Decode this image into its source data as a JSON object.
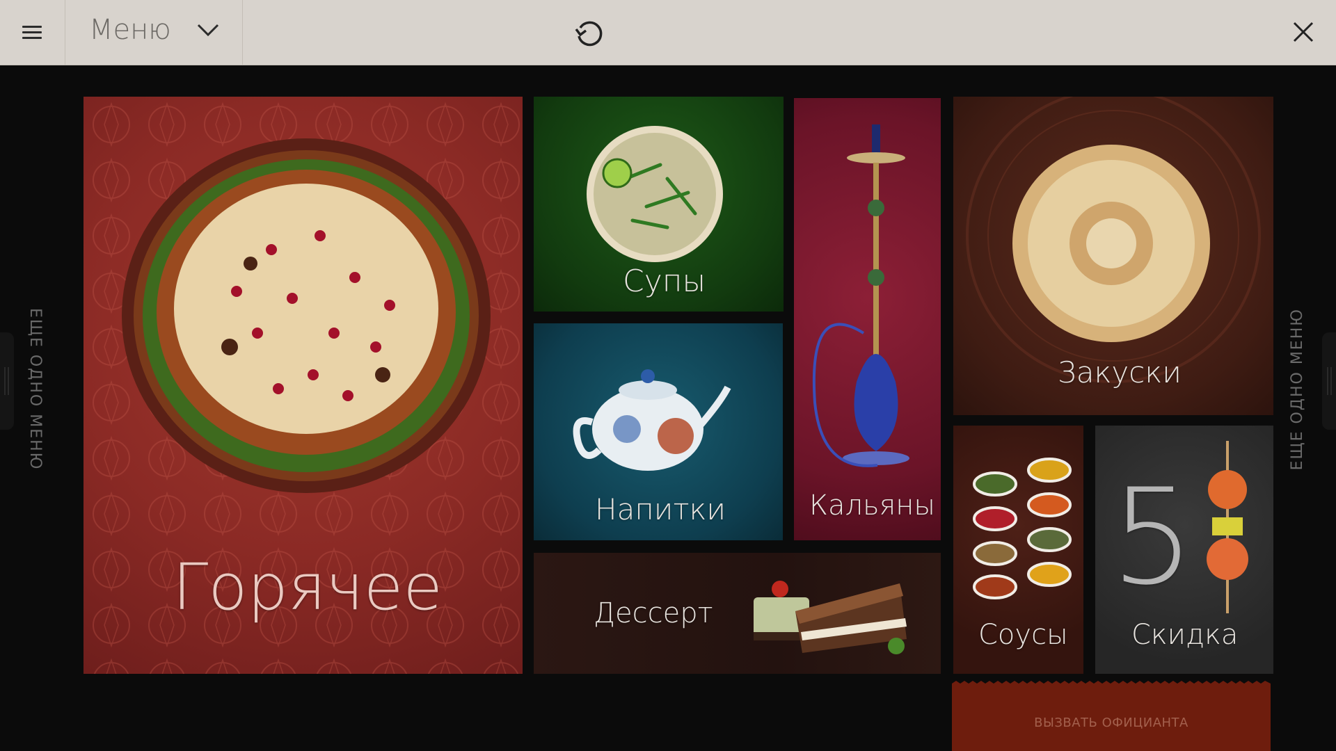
{
  "topbar": {
    "menu_label": "Меню",
    "icons": [
      "hamburger-icon",
      "chevron-down-icon",
      "refresh-icon",
      "close-icon"
    ]
  },
  "side": {
    "left_label": "ЕЩЕ ОДНО МЕНЮ",
    "right_label": "ЕЩЕ ОДНО МЕНЮ"
  },
  "tiles": {
    "hot": "Горячее",
    "soups": "Супы",
    "drinks": "Напитки",
    "hookahs": "Кальяны",
    "snacks": "Закуски",
    "dessert": "Дессерт",
    "sauces": "Соусы",
    "discount": "Скидка",
    "discount_value": "5"
  },
  "waiter_button": "ВЫЗВАТЬ ОФИЦИАНТА",
  "colors": {
    "topbar": "#d8d3cd",
    "background": "#0b0b0b",
    "hot": "#8b2a25",
    "soups": "#123b0f",
    "drinks": "#0e3e4f",
    "hookahs": "#6b1428",
    "snacks": "#3f1c13",
    "dessert": "#23120f",
    "sauces": "#34140e",
    "discount": "#262626",
    "waiter": "#6e1d0d"
  }
}
